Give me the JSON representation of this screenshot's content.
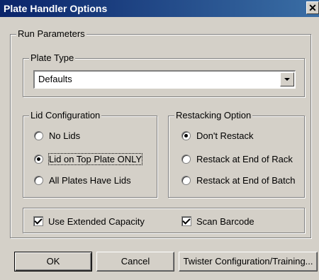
{
  "window": {
    "title": "Plate Handler Options",
    "close_symbol": "✕"
  },
  "run_parameters": {
    "legend": "Run Parameters"
  },
  "plate_type": {
    "legend": "Plate Type",
    "selected": "Defaults"
  },
  "lid_configuration": {
    "legend": "Lid Configuration",
    "options": [
      {
        "label": "No Lids",
        "selected": false
      },
      {
        "label": "Lid on Top Plate ONLY",
        "selected": true
      },
      {
        "label": "All Plates Have Lids",
        "selected": false
      }
    ]
  },
  "restacking": {
    "legend": "Restacking Option",
    "options": [
      {
        "label": "Don't Restack",
        "selected": true
      },
      {
        "label": "Restack at End of Rack",
        "selected": false
      },
      {
        "label": "Restack at End of Batch",
        "selected": false
      }
    ]
  },
  "options": {
    "use_extended_capacity": {
      "label": "Use Extended Capacity",
      "checked": true
    },
    "scan_barcode": {
      "label": "Scan Barcode",
      "checked": true
    }
  },
  "buttons": {
    "ok": "OK",
    "cancel": "Cancel",
    "twister": "Twister Configuration/Training..."
  }
}
